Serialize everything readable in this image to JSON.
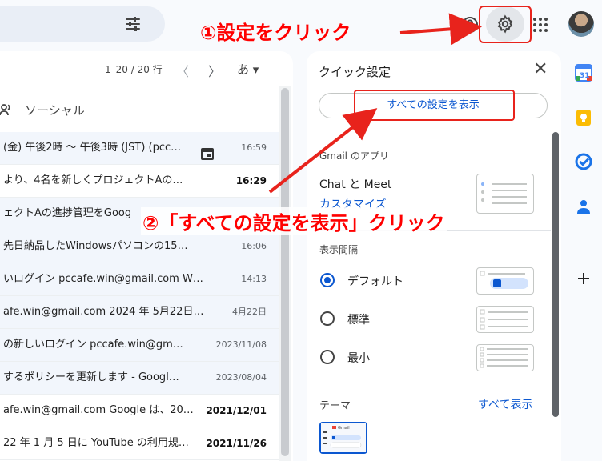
{
  "header": {
    "settings_tooltip": "設定"
  },
  "annotations": {
    "step1": "①設定をクリック",
    "step2": "②「すべての設定を表示」クリック"
  },
  "mail": {
    "pager": "1–20 / 20 行",
    "input_tool": "あ ▾",
    "social_tab": "ソーシャル",
    "rows": [
      {
        "snippet": "(金) 午後2時 ～ 午後3時 (JST) (pcc…",
        "date": "16:59",
        "state": "read",
        "has_calendar": true
      },
      {
        "snippet": "より、4名を新しくプロジェクトAの…",
        "date": "16:29",
        "state": "unread",
        "has_calendar": false
      },
      {
        "snippet": "ェクトAの進捗管理をGoog",
        "date": "",
        "state": "read",
        "has_calendar": false
      },
      {
        "snippet": "先日納品したWindowsパソコンの15…",
        "date": "16:06",
        "state": "read",
        "has_calendar": false
      },
      {
        "snippet": "いログイン pccafe.win@gmail.com W…",
        "date": "14:13",
        "state": "read",
        "has_calendar": false
      },
      {
        "snippet": "afe.win@gmail.com 2024 年 5月22日…",
        "date": "4月22日",
        "state": "read",
        "has_calendar": false
      },
      {
        "snippet": "の新しいログイン pccafe.win@gm…",
        "date": "2023/11/08",
        "state": "read",
        "has_calendar": false
      },
      {
        "snippet": "するポリシーを更新します - Googl…",
        "date": "2023/08/04",
        "state": "read",
        "has_calendar": false
      },
      {
        "snippet": "afe.win@gmail.com Google は、20…",
        "date": "2021/12/01",
        "state": "unread",
        "has_calendar": false
      },
      {
        "snippet": "22 年 1 月 5 日に YouTube の利用規…",
        "date": "2021/11/26",
        "state": "unread",
        "has_calendar": false
      }
    ]
  },
  "quick_settings": {
    "title": "クイック設定",
    "show_all_button": "すべての設定を表示",
    "apps_section": "Gmail のアプリ",
    "chat_meet": "Chat と Meet",
    "customize": "カスタマイズ",
    "density_section": "表示間隔",
    "density_options": [
      {
        "label": "デフォルト",
        "selected": true
      },
      {
        "label": "標準",
        "selected": false
      },
      {
        "label": "最小",
        "selected": false
      }
    ],
    "theme_section": "テーマ",
    "theme_view_all": "すべて表示",
    "theme_thumb_label": "Gmail"
  },
  "colors": {
    "accent": "#0b57d0",
    "annotation_red": "#ff0000"
  }
}
